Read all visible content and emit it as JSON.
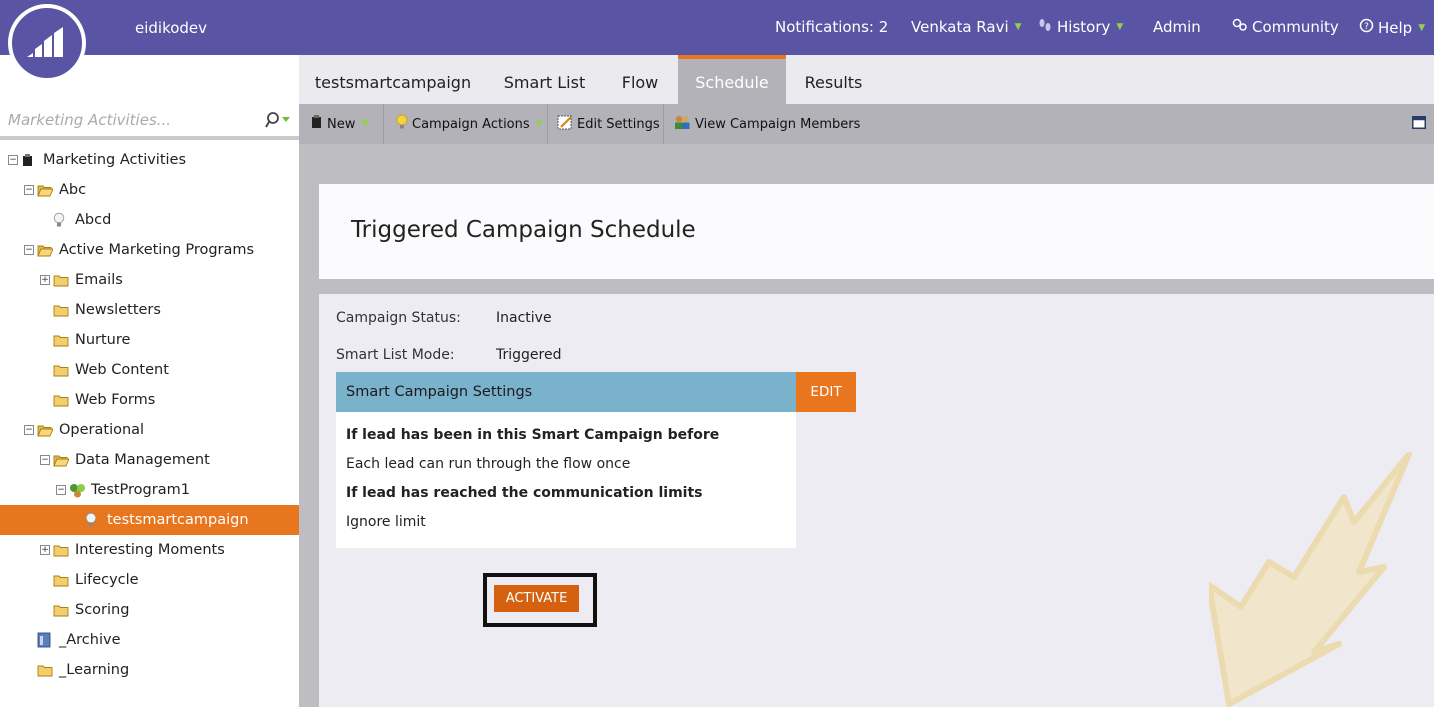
{
  "header": {
    "instance": "eidikodev",
    "notifications": "Notifications: 2",
    "user": "Venkata Ravi",
    "history": "History",
    "admin": "Admin",
    "community": "Community",
    "help": "Help"
  },
  "sidebar": {
    "search_placeholder": "Marketing Activities...",
    "tree": [
      {
        "label": "Marketing Activities",
        "icon": "root-icon",
        "expander": "−"
      },
      {
        "label": "Abc",
        "icon": "folder-open-icon",
        "expander": "−"
      },
      {
        "label": "Abcd",
        "icon": "lightbulb-icon",
        "expander": ""
      },
      {
        "label": "Active Marketing Programs",
        "icon": "folder-open-icon",
        "expander": "−"
      },
      {
        "label": "Emails",
        "icon": "folder-icon",
        "expander": "+"
      },
      {
        "label": "Newsletters",
        "icon": "folder-icon",
        "expander": ""
      },
      {
        "label": "Nurture",
        "icon": "folder-icon",
        "expander": ""
      },
      {
        "label": "Web Content",
        "icon": "folder-icon",
        "expander": ""
      },
      {
        "label": "Web Forms",
        "icon": "folder-icon",
        "expander": ""
      },
      {
        "label": "Operational",
        "icon": "folder-open-icon",
        "expander": "−"
      },
      {
        "label": "Data Management",
        "icon": "folder-open-icon",
        "expander": "−"
      },
      {
        "label": "TestProgram1",
        "icon": "program-icon",
        "expander": "−"
      },
      {
        "label": "testsmartcampaign",
        "icon": "lightbulb-icon",
        "expander": "",
        "selected": true
      },
      {
        "label": "Interesting Moments",
        "icon": "folder-icon",
        "expander": "+"
      },
      {
        "label": "Lifecycle",
        "icon": "folder-icon",
        "expander": ""
      },
      {
        "label": "Scoring",
        "icon": "folder-icon",
        "expander": ""
      },
      {
        "label": "_Archive",
        "icon": "archive-icon",
        "expander": ""
      },
      {
        "label": "_Learning",
        "icon": "folder-icon",
        "expander": ""
      }
    ]
  },
  "tabs": [
    {
      "label": "testsmartcampaign"
    },
    {
      "label": "Smart List"
    },
    {
      "label": "Flow"
    },
    {
      "label": "Schedule",
      "active": true
    },
    {
      "label": "Results"
    }
  ],
  "toolbar": {
    "new": "New",
    "campaign_actions": "Campaign Actions",
    "edit_settings": "Edit Settings",
    "view_members": "View Campaign Members"
  },
  "main": {
    "title": "Triggered Campaign Schedule",
    "status_label": "Campaign Status:",
    "status_value": "Inactive",
    "mode_label": "Smart List Mode:",
    "mode_value": "Triggered",
    "settings_title": "Smart Campaign Settings",
    "edit_label": "EDIT",
    "settings": {
      "q1": "If lead has been in this Smart Campaign before",
      "a1": "Each lead can run through the flow once",
      "q2": "If lead has reached the communication limits",
      "a2": "Ignore limit"
    },
    "activate_label": "ACTIVATE"
  },
  "colors": {
    "header_bg": "#5a54a4",
    "accent_orange": "#e8761e",
    "settings_header": "#7ab1cb",
    "activate": "#d5600f"
  }
}
